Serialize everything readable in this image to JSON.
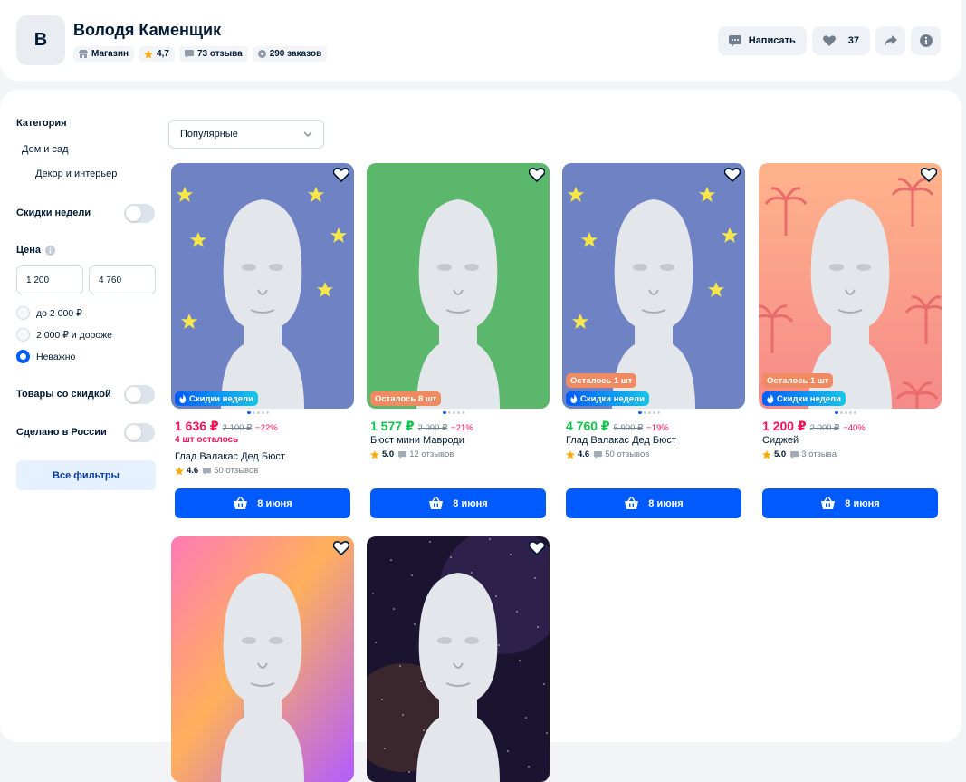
{
  "shop": {
    "avatar_letter": "В",
    "name": "Володя Каменщик",
    "chips": [
      {
        "icon": "store-icon",
        "label": "Магазин"
      },
      {
        "icon": "star-icon",
        "label": "4,7"
      },
      {
        "icon": "chat-icon",
        "label": "73 отзыва"
      },
      {
        "icon": "box-icon",
        "label": "290 заказов"
      }
    ],
    "actions": {
      "write_label": "Написать",
      "likes": "37"
    }
  },
  "filters": {
    "category_title": "Категория",
    "category_items": [
      "Дом и сад",
      "Декор и интерьер"
    ],
    "week_discounts": "Скидки недели",
    "price_title": "Цена",
    "price_from": "1 200",
    "price_to": "4 760",
    "price_options": [
      "до 2 000 ₽",
      "2 000 ₽ и дороже",
      "Неважно"
    ],
    "selected_price_option": "Неважно",
    "discounted": "Товары со скидкой",
    "made_in_russia": "Сделано в России",
    "all_filters": "Все фильтры"
  },
  "sort": {
    "selected": "Популярные"
  },
  "products": [
    {
      "bg": "blue-stars",
      "badges": [
        "Скидки недели"
      ],
      "price": "1 636 ₽",
      "old": "2 100 ₽",
      "disc": "−22%",
      "price_color": "#f91155",
      "stock": "4 шт осталось",
      "name": "Глад Валакас Дед Бюст",
      "rating": "4.6",
      "reviews": "50 отзывов",
      "delivery": "8 июня"
    },
    {
      "bg": "green",
      "badges": [
        "Осталось 8 шт"
      ],
      "price": "1 577 ₽",
      "old": "2 000 ₽",
      "disc": "−21%",
      "price_color": "#10c44c",
      "stock": "",
      "name": "Бюст мини Мавроди",
      "rating": "5.0",
      "reviews": "12 отзывов",
      "delivery": "8 июня"
    },
    {
      "bg": "blue-stars",
      "badges": [
        "Осталось 1 шт",
        "Скидки недели"
      ],
      "price": "4 760 ₽",
      "old": "5 900 ₽",
      "disc": "−19%",
      "price_color": "#10c44c",
      "stock": "",
      "name": "Глад Валакас Дед Бюст",
      "rating": "4.6",
      "reviews": "50 отзывов",
      "delivery": "8 июня"
    },
    {
      "bg": "palms",
      "badges": [
        "Осталось 1 шт",
        "Скидки недели"
      ],
      "price": "1 200 ₽",
      "old": "2 000 ₽",
      "disc": "−40%",
      "price_color": "#f91155",
      "stock": "",
      "name": "Сиджей",
      "rating": "5.0",
      "reviews": "3 отзыва",
      "delivery": "8 июня"
    },
    {
      "bg": "rainbow",
      "badges": [],
      "price": "",
      "old": "",
      "disc": "",
      "price_color": "#f91155",
      "stock": "",
      "name": "",
      "rating": "",
      "reviews": "",
      "delivery": ""
    },
    {
      "bg": "space",
      "badges": [],
      "price": "",
      "old": "",
      "disc": "",
      "price_color": "#f91155",
      "stock": "",
      "name": "",
      "rating": "",
      "reviews": "",
      "delivery": ""
    }
  ],
  "colors": {
    "accent": "#005bff",
    "sale": "#f91155",
    "green_price": "#10c44c"
  }
}
